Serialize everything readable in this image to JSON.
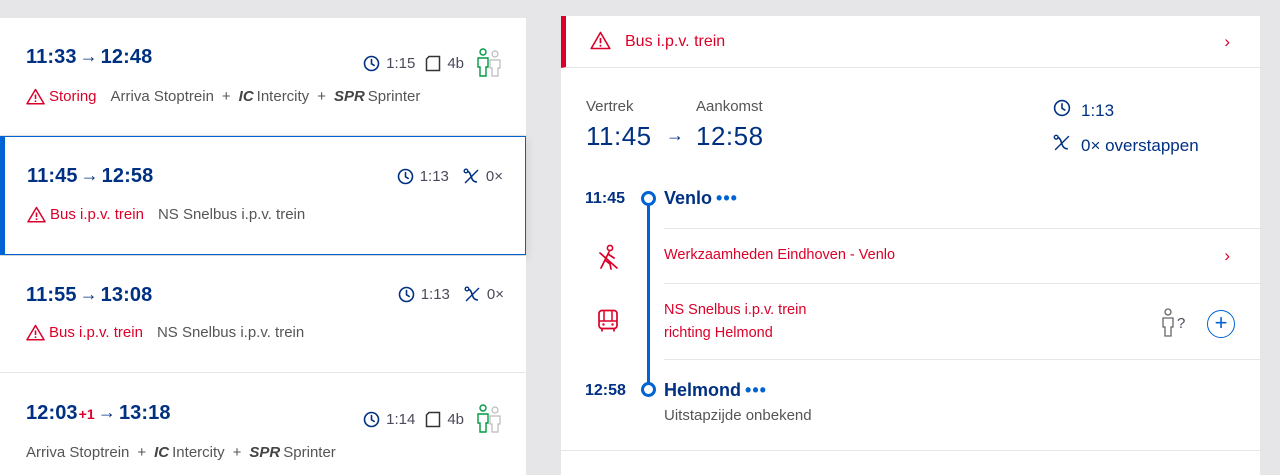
{
  "trips": [
    {
      "depart": "11:33",
      "arrow": "→",
      "arrive": "12:48",
      "delay": "",
      "duration": "1:15",
      "platform": "4b",
      "transfers": "",
      "alert": "Storing",
      "products": [
        {
          "code": "",
          "name": "Arriva Stoptrein"
        },
        {
          "code": "IC",
          "name": "Intercity"
        },
        {
          "code": "SPR",
          "name": "Sprinter"
        }
      ]
    },
    {
      "depart": "11:45",
      "arrow": "→",
      "arrive": "12:58",
      "delay": "",
      "duration": "1:13",
      "platform": "",
      "transfers": "0×",
      "alert": "Bus i.p.v. trein",
      "products": [
        {
          "code": "",
          "name": "NS Snelbus i.p.v. trein"
        }
      ]
    },
    {
      "depart": "11:55",
      "arrow": "→",
      "arrive": "13:08",
      "delay": "",
      "duration": "1:13",
      "platform": "",
      "transfers": "0×",
      "alert": "Bus i.p.v. trein",
      "products": [
        {
          "code": "",
          "name": "NS Snelbus i.p.v. trein"
        }
      ]
    },
    {
      "depart": "12:03",
      "arrow": "→",
      "arrive": "13:18",
      "delay": "+1",
      "duration": "1:14",
      "platform": "4b",
      "transfers": "",
      "alert": "",
      "products": [
        {
          "code": "",
          "name": "Arriva Stoptrein"
        },
        {
          "code": "IC",
          "name": "Intercity"
        },
        {
          "code": "SPR",
          "name": "Sprinter"
        }
      ]
    }
  ],
  "separator": "+",
  "detail": {
    "notice": "Bus i.p.v. trein",
    "notice_chevron": "›",
    "vertrek_label": "Vertrek",
    "aankomst_label": "Aankomst",
    "depart": "11:45",
    "arrow": "→",
    "arrive": "12:58",
    "duration": "1:13",
    "transfers": "0× overstappen",
    "stops": [
      {
        "time": "11:45",
        "name": "Venlo",
        "more": "•••"
      },
      {
        "time": "12:58",
        "name": "Helmond",
        "more": "•••",
        "sub": "Uitstapzijde onbekend"
      }
    ],
    "works": "Werkzaamheden Eindhoven - Venlo",
    "leg_line1": "NS Snelbus i.p.v. trein",
    "leg_line2": "richting Helmond",
    "crowd_unknown": "?",
    "add": "+"
  },
  "colors": {
    "brand_blue": "#003082",
    "accent_blue": "#0063d3",
    "alert_red": "#db0029",
    "crowd_green": "#009a42"
  },
  "icons": [
    "warning-icon",
    "clock-icon",
    "platform-icon",
    "transfer-icon",
    "crowd-icon",
    "chevron-right-icon",
    "bus-icon",
    "worker-icon",
    "plus-icon"
  ]
}
